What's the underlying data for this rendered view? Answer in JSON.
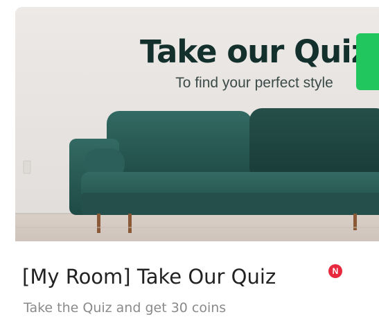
{
  "banner": {
    "title": "Take our Quiz",
    "subtitle": "To find your perfect style"
  },
  "quiz": {
    "title": "[My Room] Take Our Quiz",
    "new_badge": "N",
    "description": "Take the Quiz and get 30 coins"
  },
  "colors": {
    "title_text": "#14302c",
    "sofa": "#2a5b55",
    "badge": "#e8283d",
    "button": "#22c65e"
  }
}
